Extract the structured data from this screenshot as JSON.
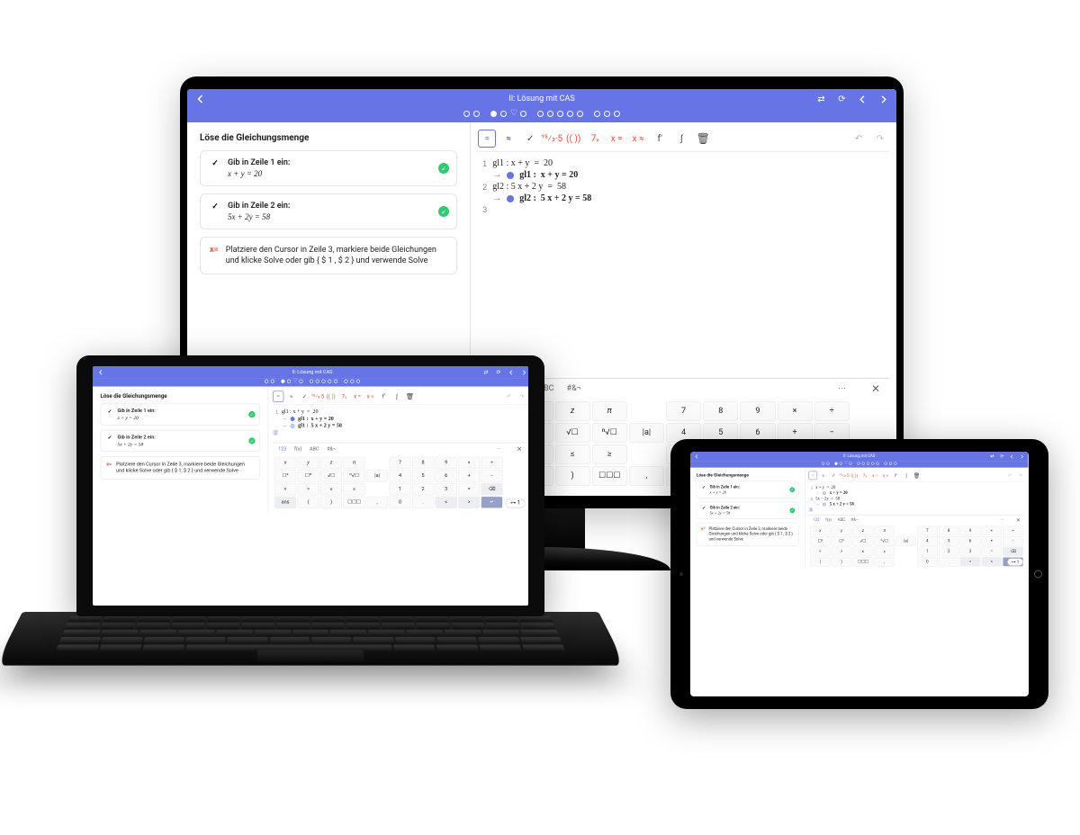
{
  "header": {
    "title": "II: Lösung mit CAS"
  },
  "lesson": {
    "heading": "Löse die Gleichungsmenge",
    "step1": {
      "label": "Gib in Zeile 1 ein:",
      "equation": "x + y = 20"
    },
    "step2": {
      "label": "Gib in Zeile 2 ein:",
      "equation": "5x + 2y = 58"
    },
    "tip": {
      "icon": "x=",
      "text": "Platziere den Cursor in Zeile 3, markiere beide Gleichungen und klicke Solve oder gib { $ 1 , $ 2 } und verwende Solve"
    },
    "tip_laptop": {
      "text": "Platziere den Cursor in Zeile 3, markiere beide Gleichungen und klicke Solve oder gib { $ 1, $ 2 } und verwende Solve"
    }
  },
  "toolbar": {
    "items": [
      "=",
      "≈",
      "✓",
      "15⁄3·5",
      "(( ))",
      "7ₓ",
      "x =",
      "x ≈",
      "f'",
      "∫",
      "🗑"
    ],
    "undo": "↶",
    "redo": "↷"
  },
  "cas": {
    "lines": [
      {
        "n": "1",
        "in": "gl1 : x + y  =  20",
        "out": "gl1 :  x + y = 20"
      },
      {
        "n": "2",
        "in": "gl2 : 5 x + 2 y  =  58",
        "out": "gl2 :  5 x + 2 y = 58"
      },
      {
        "n": "3",
        "in": "",
        "out": ""
      }
    ],
    "laptop_extra_out": "gl1 :  5 x + 2 y = 58",
    "tablet_lines": [
      {
        "n": "1",
        "in": "x + y  =  20",
        "out": " x + y = 20"
      },
      {
        "n": "2",
        "in": "5x − 2y  =  58",
        "out": " 5 x + 2 y = 58"
      },
      {
        "n": "3",
        "in": "",
        "out": ""
      }
    ]
  },
  "keyboard": {
    "tabs": {
      "t1": "123",
      "t2": "f(x)",
      "t3": "ABC",
      "t4": "#&¬"
    },
    "keys": {
      "row1": [
        "x",
        "y",
        "z",
        "π",
        "7",
        "8",
        "9",
        "×",
        "÷"
      ],
      "row2": [
        "☐²",
        "☐ⁿ",
        "√☐",
        "ⁿ√☐",
        "|a|",
        "4",
        "5",
        "6",
        "+",
        "−"
      ],
      "row3": [
        "<",
        ">",
        "≤",
        "≥",
        "1",
        "2",
        "3",
        "=",
        "⌫"
      ],
      "row4": [
        "ans",
        "(",
        ")",
        "☐☐☐",
        ",",
        "0",
        ".",
        "<",
        ">",
        "↵"
      ],
      "row4_tablet": [
        "(",
        ")",
        "☐☐☐",
        ",",
        "0",
        ".",
        "<",
        ">",
        "↵"
      ]
    }
  },
  "help_pill": "⊶ 1"
}
